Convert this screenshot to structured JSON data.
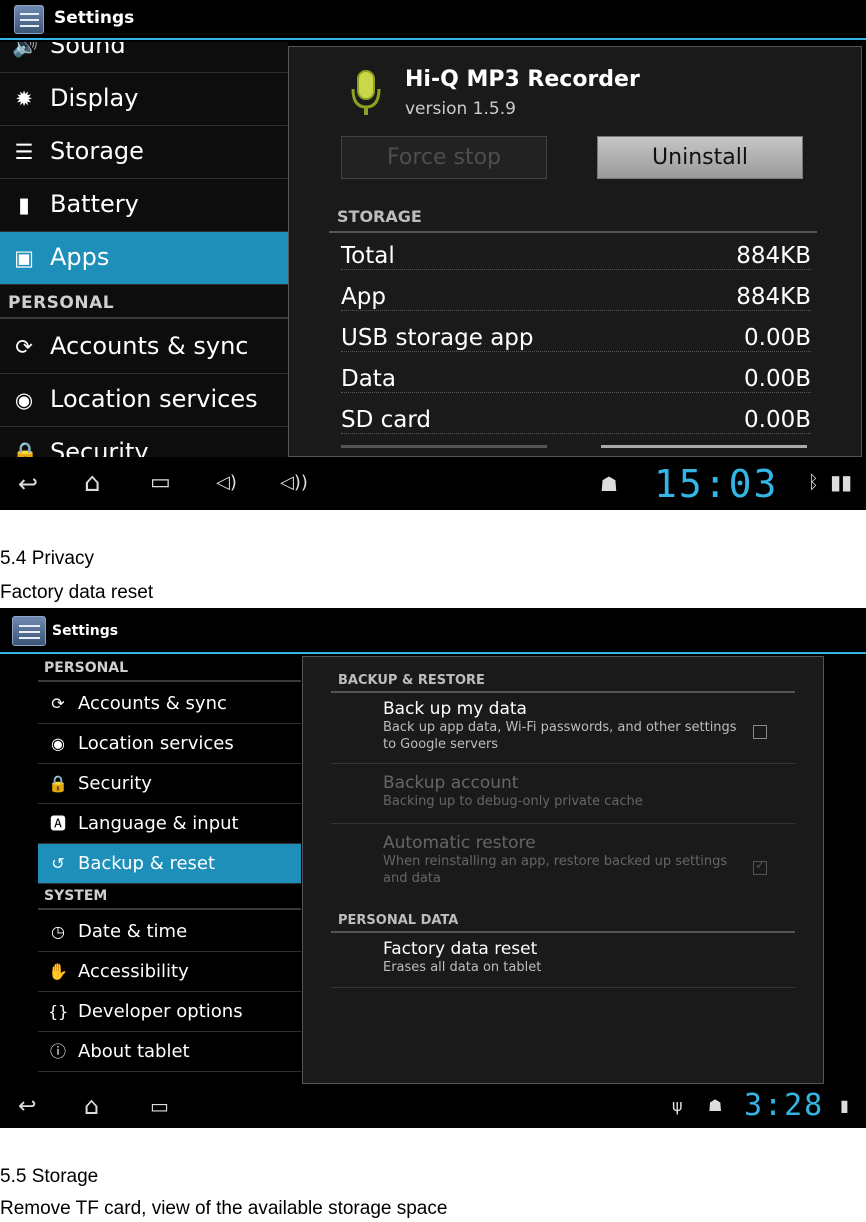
{
  "screen1": {
    "title": "Settings",
    "left_items": [
      {
        "label": "Sound",
        "icon": "speaker-icon"
      },
      {
        "label": "Display",
        "icon": "gear-icon"
      },
      {
        "label": "Storage",
        "icon": "storage-icon"
      },
      {
        "label": "Battery",
        "icon": "battery-icon"
      },
      {
        "label": "Apps",
        "icon": "apps-icon",
        "selected": true
      }
    ],
    "personal_header": "PERSONAL",
    "personal_items": [
      {
        "label": "Accounts & sync",
        "icon": "sync-icon"
      },
      {
        "label": "Location services",
        "icon": "location-icon"
      },
      {
        "label": "Security",
        "icon": "lock-icon"
      }
    ],
    "app": {
      "name": "Hi-Q MP3 Recorder",
      "version": "version 1.5.9",
      "force_stop": "Force stop",
      "uninstall": "Uninstall"
    },
    "storage_header": "STORAGE",
    "storage_rows": [
      {
        "label": "Total",
        "value": "884KB"
      },
      {
        "label": "App",
        "value": "884KB"
      },
      {
        "label": "USB storage app",
        "value": "0.00B"
      },
      {
        "label": "Data",
        "value": "0.00B"
      },
      {
        "label": "SD card",
        "value": "0.00B"
      }
    ],
    "clock": "15:03"
  },
  "doc": {
    "heading1": "5.4 Privacy",
    "text1": "Factory data reset",
    "heading2": "5.5 Storage",
    "text2": "Remove TF card, view of the available storage space"
  },
  "screen2": {
    "title": "Settings",
    "personal_header": "PERSONAL",
    "personal_items": [
      {
        "label": "Accounts & sync",
        "icon": "sync-icon"
      },
      {
        "label": "Location services",
        "icon": "location-icon"
      },
      {
        "label": "Security",
        "icon": "lock-icon"
      },
      {
        "label": "Language & input",
        "icon": "keyboard-icon"
      },
      {
        "label": "Backup & reset",
        "icon": "backup-icon",
        "selected": true
      }
    ],
    "system_header": "SYSTEM",
    "system_items": [
      {
        "label": "Date & time",
        "icon": "clock-icon"
      },
      {
        "label": "Accessibility",
        "icon": "hand-icon"
      },
      {
        "label": "Developer options",
        "icon": "braces-icon"
      },
      {
        "label": "About tablet",
        "icon": "info-icon"
      }
    ],
    "backup_header": "BACKUP & RESTORE",
    "backup_items": [
      {
        "title": "Back up my data",
        "summary": "Back up app data, Wi-Fi passwords, and other settings to Google servers",
        "checked": false,
        "enabled": true
      },
      {
        "title": "Backup account",
        "summary": "Backing up to debug-only private cache",
        "enabled": false
      },
      {
        "title": "Automatic restore",
        "summary": "When reinstalling an app, restore backed up settings and data",
        "checked": true,
        "enabled": false
      }
    ],
    "personal_data_header": "PERSONAL DATA",
    "reset_item": {
      "title": "Factory data reset",
      "summary": "Erases all data on tablet"
    },
    "clock": "3:28"
  },
  "colors": {
    "accent": "#33b5e5",
    "selected": "#1d8fb8"
  }
}
